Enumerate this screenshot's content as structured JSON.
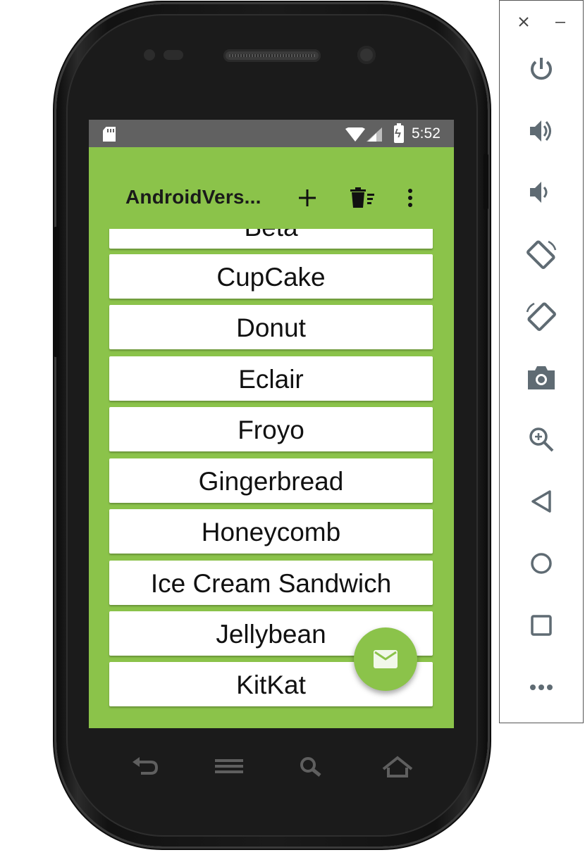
{
  "statusbar": {
    "time": "5:52"
  },
  "toolbar": {
    "title": "AndroidVers..."
  },
  "list": {
    "items": [
      "Beta",
      "CupCake",
      "Donut",
      "Eclair",
      "Froyo",
      "Gingerbread",
      "Honeycomb",
      "Ice Cream Sandwich",
      "Jellybean",
      "KitKat"
    ]
  },
  "colors": {
    "primary": "#8bc34a",
    "status_bar": "#616161",
    "card": "#ffffff",
    "text": "#111111"
  },
  "icons": {
    "toolbar": [
      "add-icon",
      "delete-sweep-icon",
      "overflow-menu-icon"
    ],
    "fab": "email-icon",
    "emulator": [
      "close-icon",
      "minimize-icon",
      "power-icon",
      "volume-up-icon",
      "volume-down-icon",
      "rotate-left-icon",
      "rotate-right-icon",
      "camera-icon",
      "zoom-icon",
      "back-icon",
      "home-icon",
      "overview-icon",
      "more-icon"
    ]
  }
}
